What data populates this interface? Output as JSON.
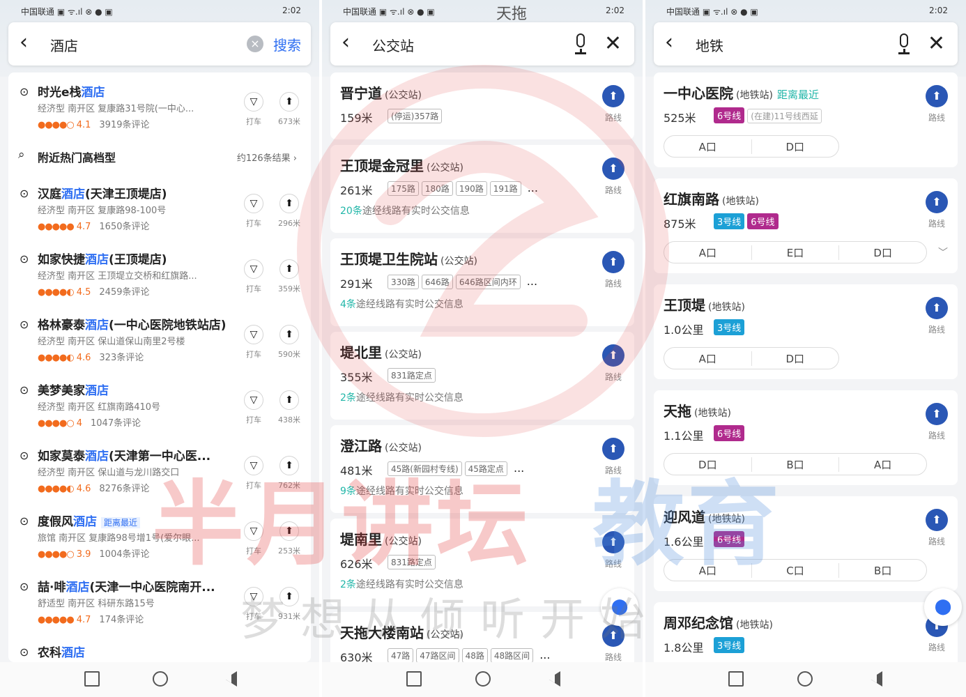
{
  "status": {
    "carrier": "中国联通 ▣ ᯤ.ıl ⊗ ● ▣",
    "time": "2:02",
    "icons": "ⓧ ✱ ⊙ ▭",
    "map_name": "天拖"
  },
  "screen1": {
    "query": "酒店",
    "search_label": "搜索",
    "hot_row": {
      "label": "附近热门高档型",
      "more": "约126条结果 ›"
    },
    "hotels": [
      {
        "name_pre": "时光e栈",
        "name_hl": "酒店",
        "name_post": "",
        "tag": "",
        "desc": "经济型 南开区 复康路31号院(一中心...",
        "stars": "●●●●○",
        "score": "4.1",
        "reviews": "3919条评论",
        "taxi": "打车",
        "route_dist": "673米"
      },
      {
        "name_pre": "汉庭",
        "name_hl": "酒店",
        "name_post": "(天津王顶堤店)",
        "tag": "",
        "desc": "经济型 南开区 复康路98-100号",
        "stars": "●●●●●",
        "score": "4.7",
        "reviews": "1650条评论",
        "taxi": "打车",
        "route_dist": "296米"
      },
      {
        "name_pre": "如家快捷",
        "name_hl": "酒店",
        "name_post": "(王顶堤店)",
        "tag": "",
        "desc": "经济型 南开区 王顶堤立交桥和红旗路...",
        "stars": "●●●●◐",
        "score": "4.5",
        "reviews": "2459条评论",
        "taxi": "打车",
        "route_dist": "359米"
      },
      {
        "name_pre": "格林豪泰",
        "name_hl": "酒店",
        "name_post": "(一中心医院地铁站店)",
        "tag": "",
        "desc": "经济型 南开区 保山道保山南里2号楼",
        "stars": "●●●●◐",
        "score": "4.6",
        "reviews": "323条评论",
        "taxi": "打车",
        "route_dist": "590米"
      },
      {
        "name_pre": "美梦美家",
        "name_hl": "酒店",
        "name_post": "",
        "tag": "",
        "desc": "经济型 南开区 红旗南路410号",
        "stars": "●●●●○",
        "score": "4",
        "reviews": "1047条评论",
        "taxi": "打车",
        "route_dist": "438米"
      },
      {
        "name_pre": "如家莫泰",
        "name_hl": "酒店",
        "name_post": "(天津第一中心医...",
        "tag": "",
        "desc": "经济型 南开区 保山道与龙川路交口",
        "stars": "●●●●◐",
        "score": "4.6",
        "reviews": "8276条评论",
        "taxi": "打车",
        "route_dist": "762米"
      },
      {
        "name_pre": "度假风",
        "name_hl": "酒店",
        "name_post": "",
        "tag": "距离最近",
        "desc": "旅馆 南开区 复康路98号增1号(爱尔眼...",
        "stars": "●●●●○",
        "score": "3.9",
        "reviews": "1004条评论",
        "taxi": "打车",
        "route_dist": "253米"
      },
      {
        "name_pre": "喆·啡",
        "name_hl": "酒店",
        "name_post": "(天津一中心医院南开...",
        "tag": "",
        "desc": "舒适型 南开区 科研东路15号",
        "stars": "●●●●●",
        "score": "4.7",
        "reviews": "174条评论",
        "taxi": "打车",
        "route_dist": "931米"
      },
      {
        "name_pre": "农科",
        "name_hl": "酒店",
        "name_post": "",
        "tag": "",
        "desc": "",
        "stars": "",
        "score": "",
        "reviews": "",
        "taxi": "",
        "route_dist": ""
      }
    ]
  },
  "screen2": {
    "query": "公交站",
    "route_label": "路线",
    "stops": [
      {
        "name": "晋宁道",
        "kind": "(公交站)",
        "dist": "159米",
        "lines": [
          "(停运)357路"
        ],
        "rt_n": "",
        "rt_text": ""
      },
      {
        "name": "王顶堤金冠里",
        "kind": "(公交站)",
        "dist": "261米",
        "lines": [
          "175路",
          "180路",
          "190路",
          "191路",
          "..."
        ],
        "rt_n": "20条",
        "rt_text": "途经线路有实时公交信息"
      },
      {
        "name": "王顶堤卫生院站",
        "kind": "(公交站)",
        "dist": "291米",
        "lines": [
          "330路",
          "646路",
          "646路区间内环",
          "..."
        ],
        "rt_n": "4条",
        "rt_text": "途经线路有实时公交信息"
      },
      {
        "name": "堤北里",
        "kind": "(公交站)",
        "dist": "355米",
        "lines": [
          "831路定点"
        ],
        "rt_n": "2条",
        "rt_text": "途经线路有实时公交信息"
      },
      {
        "name": "澄江路",
        "kind": "(公交站)",
        "dist": "481米",
        "lines": [
          "45路(新园村专线)",
          "45路定点",
          "..."
        ],
        "rt_n": "9条",
        "rt_text": "途经线路有实时公交信息"
      },
      {
        "name": "堤南里",
        "kind": "(公交站)",
        "dist": "626米",
        "lines": [
          "831路定点"
        ],
        "rt_n": "2条",
        "rt_text": "途经线路有实时公交信息"
      },
      {
        "name": "天拖大楼南站",
        "kind": "(公交站)",
        "dist": "630米",
        "lines": [
          "47路",
          "47路区间",
          "48路",
          "48路区间",
          "..."
        ],
        "rt_n": "",
        "rt_text": ""
      }
    ]
  },
  "screen3": {
    "query": "地铁",
    "route_label": "路线",
    "stations": [
      {
        "name": "一中心医院",
        "kind": "(地铁站)",
        "near": "距离最近",
        "dist": "525米",
        "lines": [
          {
            "t": "6号线",
            "c": "6"
          }
        ],
        "extra": "(在建)11号线西延",
        "exits": [
          "A口",
          "D口"
        ]
      },
      {
        "name": "红旗南路",
        "kind": "(地铁站)",
        "near": "",
        "dist": "875米",
        "lines": [
          {
            "t": "3号线",
            "c": "3"
          },
          {
            "t": "6号线",
            "c": "6"
          }
        ],
        "extra": "",
        "exits": [
          "A口",
          "E口",
          "D口"
        ]
      },
      {
        "name": "王顶堤",
        "kind": "(地铁站)",
        "near": "",
        "dist": "1.0公里",
        "lines": [
          {
            "t": "3号线",
            "c": "3"
          }
        ],
        "extra": "",
        "exits": [
          "A口",
          "D口"
        ]
      },
      {
        "name": "天拖",
        "kind": "(地铁站)",
        "near": "",
        "dist": "1.1公里",
        "lines": [
          {
            "t": "6号线",
            "c": "6"
          }
        ],
        "extra": "",
        "exits": [
          "D口",
          "B口",
          "A口"
        ]
      },
      {
        "name": "迎风道",
        "kind": "(地铁站)",
        "near": "",
        "dist": "1.6公里",
        "lines": [
          {
            "t": "6号线",
            "c": "6"
          }
        ],
        "extra": "",
        "exits": [
          "A口",
          "C口",
          "B口"
        ]
      },
      {
        "name": "周邓纪念馆",
        "kind": "(地铁站)",
        "near": "",
        "dist": "1.8公里",
        "lines": [
          {
            "t": "3号线",
            "c": "3"
          }
        ],
        "extra": "",
        "exits": []
      }
    ]
  },
  "watermark": {
    "main_red": "半月讲坛",
    "main_blue": "教育",
    "slogan": "梦想从倾听开始"
  },
  "colors": {
    "link_blue": "#2f6ff2",
    "rating_orange": "#f26b1d",
    "teal": "#21b6a8",
    "line6": "#b02a8d",
    "line3": "#1ca0d6",
    "route_button": "#2a57b5"
  }
}
